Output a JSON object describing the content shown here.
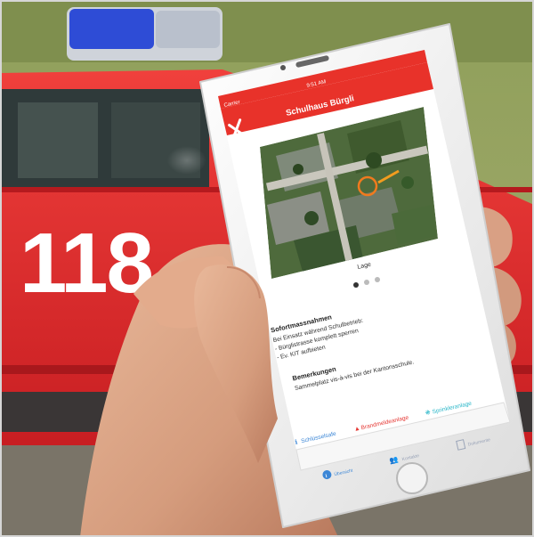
{
  "truck": {
    "number": "118"
  },
  "status_bar": {
    "carrier": "Carrier",
    "time": "9:51 AM"
  },
  "app": {
    "title": "Schulhaus Bürgli",
    "close_icon": "close-icon",
    "image_caption": "Lage",
    "carousel": {
      "count": 3,
      "active": 0
    },
    "sections": {
      "measures_title": "Sofortmassnahmen",
      "measures_lines": [
        "Bei Einsatz während Schulbetrieb:",
        "- Bürglistrasse komplett sperren",
        "- Ev. KIT aufbieten"
      ],
      "remarks_title": "Bemerkungen",
      "remarks_text": "Sammelplatz vis-à-vis bei der Kantonsschule."
    },
    "links": [
      {
        "icon": "info-icon",
        "label": "Schlüsselsafe",
        "color": "#3b86d6"
      },
      {
        "icon": "flame-icon",
        "label": "Brandmeldeanlage",
        "color": "#e53935"
      },
      {
        "icon": "sprinkler-icon",
        "label": "Sprinkleranlage",
        "color": "#2bb7c9"
      }
    ],
    "tabs": [
      {
        "icon": "info-icon",
        "label": "Übersicht",
        "active": true
      },
      {
        "icon": "people-icon",
        "label": "Kontakte",
        "active": false
      },
      {
        "icon": "docs-icon",
        "label": "Dokumente",
        "active": false
      }
    ]
  },
  "colors": {
    "accent": "#e8322a",
    "truck_red": "#e6262a",
    "link_blue": "#3b86d6"
  }
}
